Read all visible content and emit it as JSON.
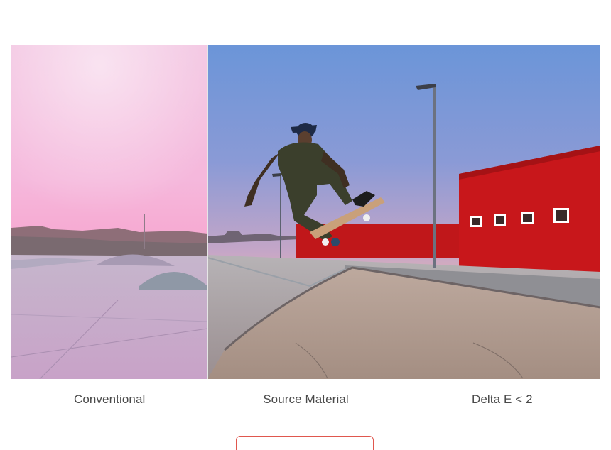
{
  "comparison": {
    "panels": [
      {
        "label": "Conventional"
      },
      {
        "label": "Source Material"
      },
      {
        "label": "Delta E < 2"
      }
    ]
  },
  "cta": {
    "label": ""
  },
  "colors": {
    "divider": "#e6e6e6",
    "wall_red": "#c8171b",
    "button_border": "#e0574e",
    "label_text": "#4a4a4a"
  }
}
